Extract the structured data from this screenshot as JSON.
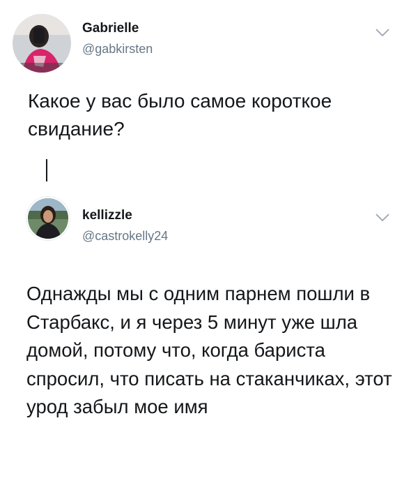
{
  "tweets": [
    {
      "name": "Gabrielle",
      "handle": "@gabkirsten",
      "text": "Какое у вас было самое короткое свидание?"
    },
    {
      "name": "kellizzle",
      "handle": "@castrokelly24",
      "text": "Однажды мы с одним парнем пошли в Старбакс, и я через 5 минут уже шла домой, потому что, когда бариста спросил, что писать на стаканчиках, этот урод забыл мое имя"
    }
  ],
  "colors": {
    "text": "#14171a",
    "secondary": "#657786",
    "chevron": "#9aa5b1"
  },
  "icons": [
    "chevron-down-icon"
  ]
}
